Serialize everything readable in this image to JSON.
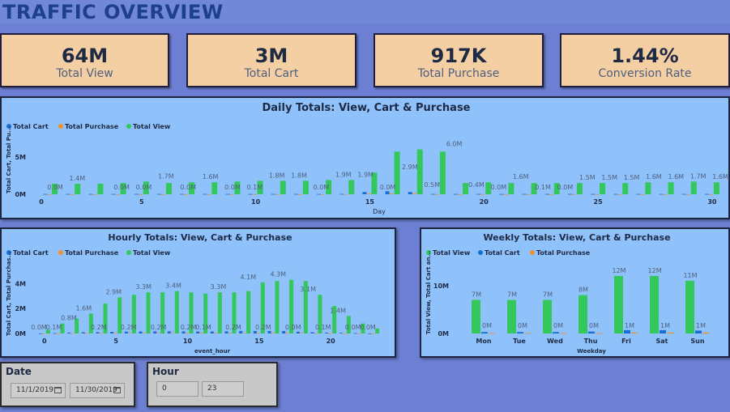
{
  "page": {
    "title": "TRAFFIC OVERVIEW"
  },
  "kpis": [
    {
      "value": "64M",
      "label": "Total View"
    },
    {
      "value": "3M",
      "label": "Total Cart"
    },
    {
      "value": "917K",
      "label": "Total Purchase"
    },
    {
      "value": "1.44%",
      "label": "Conversion Rate"
    }
  ],
  "colors": {
    "cart": "#1a6fd6",
    "purchase": "#f0902e",
    "view": "#34c75b"
  },
  "filters": {
    "date": {
      "title": "Date",
      "start": "11/1/2019",
      "end": "11/30/2019",
      "icon": "calendar-icon"
    },
    "hour": {
      "title": "Hour",
      "start": "0",
      "end": "23"
    }
  },
  "chart_data": [
    {
      "type": "bar",
      "title": "Daily Totals: View, Cart & Purchase",
      "xlabel": "Day",
      "ylabel": "Total Cart, Total Pu...",
      "legend": [
        "Total Cart",
        "Total Purchase",
        "Total View"
      ],
      "legend_placement": "top-left",
      "categories": [
        1,
        2,
        3,
        4,
        5,
        6,
        7,
        8,
        9,
        10,
        11,
        12,
        13,
        14,
        15,
        16,
        17,
        18,
        19,
        20,
        21,
        22,
        23,
        24,
        25,
        26,
        27,
        28,
        29,
        30
      ],
      "x_ticks": [
        "0",
        "5",
        "10",
        "15",
        "20",
        "25",
        "30"
      ],
      "y_ticks": [
        "0M",
        "5M"
      ],
      "ylim": [
        0,
        6.6
      ],
      "series": [
        {
          "name": "Total Cart",
          "values": [
            0.04,
            0.04,
            0.04,
            0.04,
            0.04,
            0.04,
            0.04,
            0.04,
            0.04,
            0.04,
            0.04,
            0.04,
            0.04,
            0.05,
            0.3,
            0.4,
            0.3,
            0.04,
            0.04,
            0.04,
            0.04,
            0.04,
            0.04,
            0.04,
            0.04,
            0.04,
            0.04,
            0.04,
            0.04,
            0.04
          ]
        },
        {
          "name": "Total Purchase",
          "values": [
            0.01,
            0.01,
            0.01,
            0.01,
            0.01,
            0.01,
            0.01,
            0.01,
            0.01,
            0.01,
            0.01,
            0.01,
            0.01,
            0.02,
            0.1,
            0.1,
            0.1,
            0.01,
            0.01,
            0.01,
            0.01,
            0.01,
            0.01,
            0.01,
            0.01,
            0.01,
            0.01,
            0.01,
            0.01,
            0.01
          ]
        },
        {
          "name": "Total View",
          "values": [
            1.4,
            1.4,
            1.4,
            1.5,
            1.7,
            1.5,
            1.6,
            1.6,
            1.7,
            1.8,
            1.8,
            1.8,
            1.9,
            1.9,
            2.9,
            5.7,
            6.0,
            5.7,
            1.5,
            1.6,
            1.5,
            1.5,
            1.5,
            1.5,
            1.5,
            1.5,
            1.6,
            1.6,
            1.7,
            1.6
          ]
        }
      ],
      "data_labels": [
        {
          "i": 0,
          "text": "0.0M"
        },
        {
          "i": 1,
          "text": "1.4M"
        },
        {
          "i": 3,
          "text": "0.0M"
        },
        {
          "i": 4,
          "text": "0.0M"
        },
        {
          "i": 5,
          "text": "1.7M"
        },
        {
          "i": 6,
          "text": "0.0M"
        },
        {
          "i": 7,
          "text": "1.6M"
        },
        {
          "i": 8,
          "text": "0.0M"
        },
        {
          "i": 9,
          "text": "0.1M"
        },
        {
          "i": 10,
          "text": "1.8M"
        },
        {
          "i": 11,
          "text": "1.8M"
        },
        {
          "i": 12,
          "text": "0.0M"
        },
        {
          "i": 13,
          "text": "1.9M"
        },
        {
          "i": 14,
          "text": "1.9M"
        },
        {
          "i": 15,
          "text": "0.0M"
        },
        {
          "i": 16,
          "text": "2.9M"
        },
        {
          "i": 17,
          "text": "0.5M"
        },
        {
          "i": 18,
          "text": "6.0M"
        },
        {
          "i": 19,
          "text": "0.4M"
        },
        {
          "i": 20,
          "text": "0.0M"
        },
        {
          "i": 21,
          "text": "1.6M"
        },
        {
          "i": 22,
          "text": "0.1M"
        },
        {
          "i": 23,
          "text": "0.0M"
        },
        {
          "i": 24,
          "text": "1.5M"
        },
        {
          "i": 25,
          "text": "1.5M"
        },
        {
          "i": 26,
          "text": "1.5M"
        },
        {
          "i": 27,
          "text": "1.6M"
        },
        {
          "i": 28,
          "text": "1.6M"
        },
        {
          "i": 29,
          "text": "1.7M"
        },
        {
          "i": 30,
          "text": "1.6M"
        }
      ]
    },
    {
      "type": "bar",
      "title": "Hourly Totals: View, Cart & Purchase",
      "xlabel": "event_hour",
      "ylabel": "Total Cart, Total Purchas...",
      "legend": [
        "Total Cart",
        "Total Purchase",
        "Total View"
      ],
      "legend_placement": "top-left",
      "categories": [
        0,
        1,
        2,
        3,
        4,
        5,
        6,
        7,
        8,
        9,
        10,
        11,
        12,
        13,
        14,
        15,
        16,
        17,
        18,
        19,
        20,
        21,
        22,
        23
      ],
      "x_ticks": [
        "0",
        "5",
        "10",
        "15",
        "20"
      ],
      "y_ticks": [
        "0M",
        "2M",
        "4M"
      ],
      "ylim": [
        0,
        4.8
      ],
      "series": [
        {
          "name": "Total Cart",
          "values": [
            0.01,
            0.03,
            0.07,
            0.1,
            0.1,
            0.13,
            0.15,
            0.16,
            0.17,
            0.17,
            0.17,
            0.16,
            0.16,
            0.17,
            0.2,
            0.2,
            0.2,
            0.2,
            0.15,
            0.1,
            0.07,
            0.05,
            0.03,
            0.01
          ]
        },
        {
          "name": "Total Purchase",
          "values": [
            0.0,
            0.01,
            0.02,
            0.03,
            0.03,
            0.04,
            0.05,
            0.05,
            0.05,
            0.05,
            0.05,
            0.05,
            0.05,
            0.05,
            0.06,
            0.06,
            0.06,
            0.06,
            0.05,
            0.03,
            0.02,
            0.01,
            0.01,
            0.0
          ]
        },
        {
          "name": "Total View",
          "values": [
            0.3,
            0.8,
            1.2,
            1.6,
            2.4,
            2.9,
            3.1,
            3.3,
            3.3,
            3.4,
            3.3,
            3.2,
            3.3,
            3.3,
            3.4,
            4.1,
            4.2,
            4.3,
            4.2,
            3.1,
            2.2,
            1.4,
            0.8,
            0.4
          ]
        }
      ],
      "data_labels": [
        "0.0M",
        "0.1M",
        "0.8M",
        "1.6M",
        "0.2M",
        "2.9M",
        "0.2M",
        "3.3M",
        "0.2M",
        "3.4M",
        "0.2M",
        "0.1M",
        "3.3M",
        "0.2M",
        "4.1M",
        "0.2M",
        "4.3M",
        "0.0M",
        "3.1M",
        "0.1M",
        "1.4M",
        "0.0M",
        "0.0M"
      ]
    },
    {
      "type": "bar",
      "title": "Weekly Totals: View, Cart & Purchase",
      "xlabel": "Weekday",
      "ylabel": "Total View, Total Cart an...",
      "legend": [
        "Total View",
        "Total Cart",
        "Total Purchase"
      ],
      "legend_placement": "top-left",
      "categories": [
        "Mon",
        "Tue",
        "Wed",
        "Thu",
        "Fri",
        "Sat",
        "Sun"
      ],
      "y_ticks": [
        "0M",
        "10M"
      ],
      "ylim": [
        0,
        13
      ],
      "series": [
        {
          "name": "Total View",
          "values": [
            7,
            7,
            7,
            8,
            12,
            12,
            11
          ]
        },
        {
          "name": "Total Cart",
          "values": [
            0.3,
            0.3,
            0.3,
            0.4,
            0.7,
            0.7,
            0.6
          ]
        },
        {
          "name": "Total Purchase",
          "values": [
            0.1,
            0.1,
            0.1,
            0.1,
            0.2,
            0.2,
            0.2
          ]
        }
      ],
      "data_labels": {
        "view": [
          "7M",
          "7M",
          "7M",
          "8M",
          "12M",
          "12M",
          "11M"
        ],
        "cart": [
          "0M",
          "0M",
          "0M",
          "0M",
          "1M",
          "1M",
          "1M"
        ]
      }
    }
  ]
}
